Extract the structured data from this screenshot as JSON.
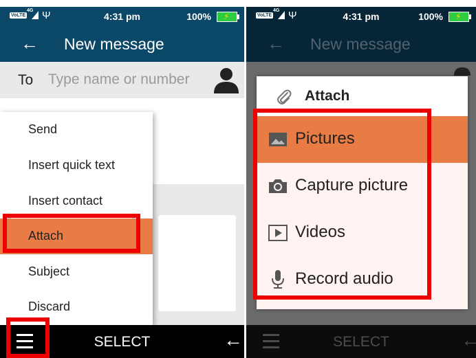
{
  "left_screen": {
    "status_bar": {
      "volte": "VoLTE",
      "network": "4G",
      "usb_glyph": "Ψ",
      "time": "4:31 pm",
      "battery": "100%"
    },
    "app_bar": {
      "back_glyph": "←",
      "title": "New message"
    },
    "to_row": {
      "label": "To",
      "placeholder": "Type name or number",
      "value": "",
      "icon": "contact-person-icon"
    },
    "options_menu": {
      "items": [
        {
          "label": "Send",
          "selected": false
        },
        {
          "label": "Insert quick text",
          "selected": false
        },
        {
          "label": "Insert contact",
          "selected": false
        },
        {
          "label": "Attach",
          "selected": true
        },
        {
          "label": "Subject",
          "selected": false
        },
        {
          "label": "Discard",
          "selected": false
        }
      ]
    },
    "softkeys": {
      "left_icon": "menu-icon",
      "center": "SELECT",
      "right_glyph": "←"
    }
  },
  "right_screen": {
    "status_bar": {
      "volte": "VoLTE",
      "network": "4G",
      "usb_glyph": "Ψ",
      "time": "4:31 pm",
      "battery": "100%"
    },
    "app_bar": {
      "back_glyph": "←",
      "title": "New message"
    },
    "attach_dialog": {
      "title": "Attach",
      "title_icon": "paperclip-icon",
      "items": [
        {
          "label": "Pictures",
          "icon": "picture-icon",
          "selected": true
        },
        {
          "label": "Capture picture",
          "icon": "camera-icon",
          "selected": false
        },
        {
          "label": "Videos",
          "icon": "video-icon",
          "selected": false
        },
        {
          "label": "Record audio",
          "icon": "microphone-icon",
          "selected": false
        }
      ]
    },
    "softkeys": {
      "left_icon": "menu-icon",
      "center": "SELECT",
      "right_glyph": "←"
    }
  },
  "colors": {
    "header": "#0b4766",
    "header_dimmed": "#062637",
    "selection": "#e97c44",
    "highlight_box": "#ee0000",
    "list_background": "#fef3f0"
  }
}
